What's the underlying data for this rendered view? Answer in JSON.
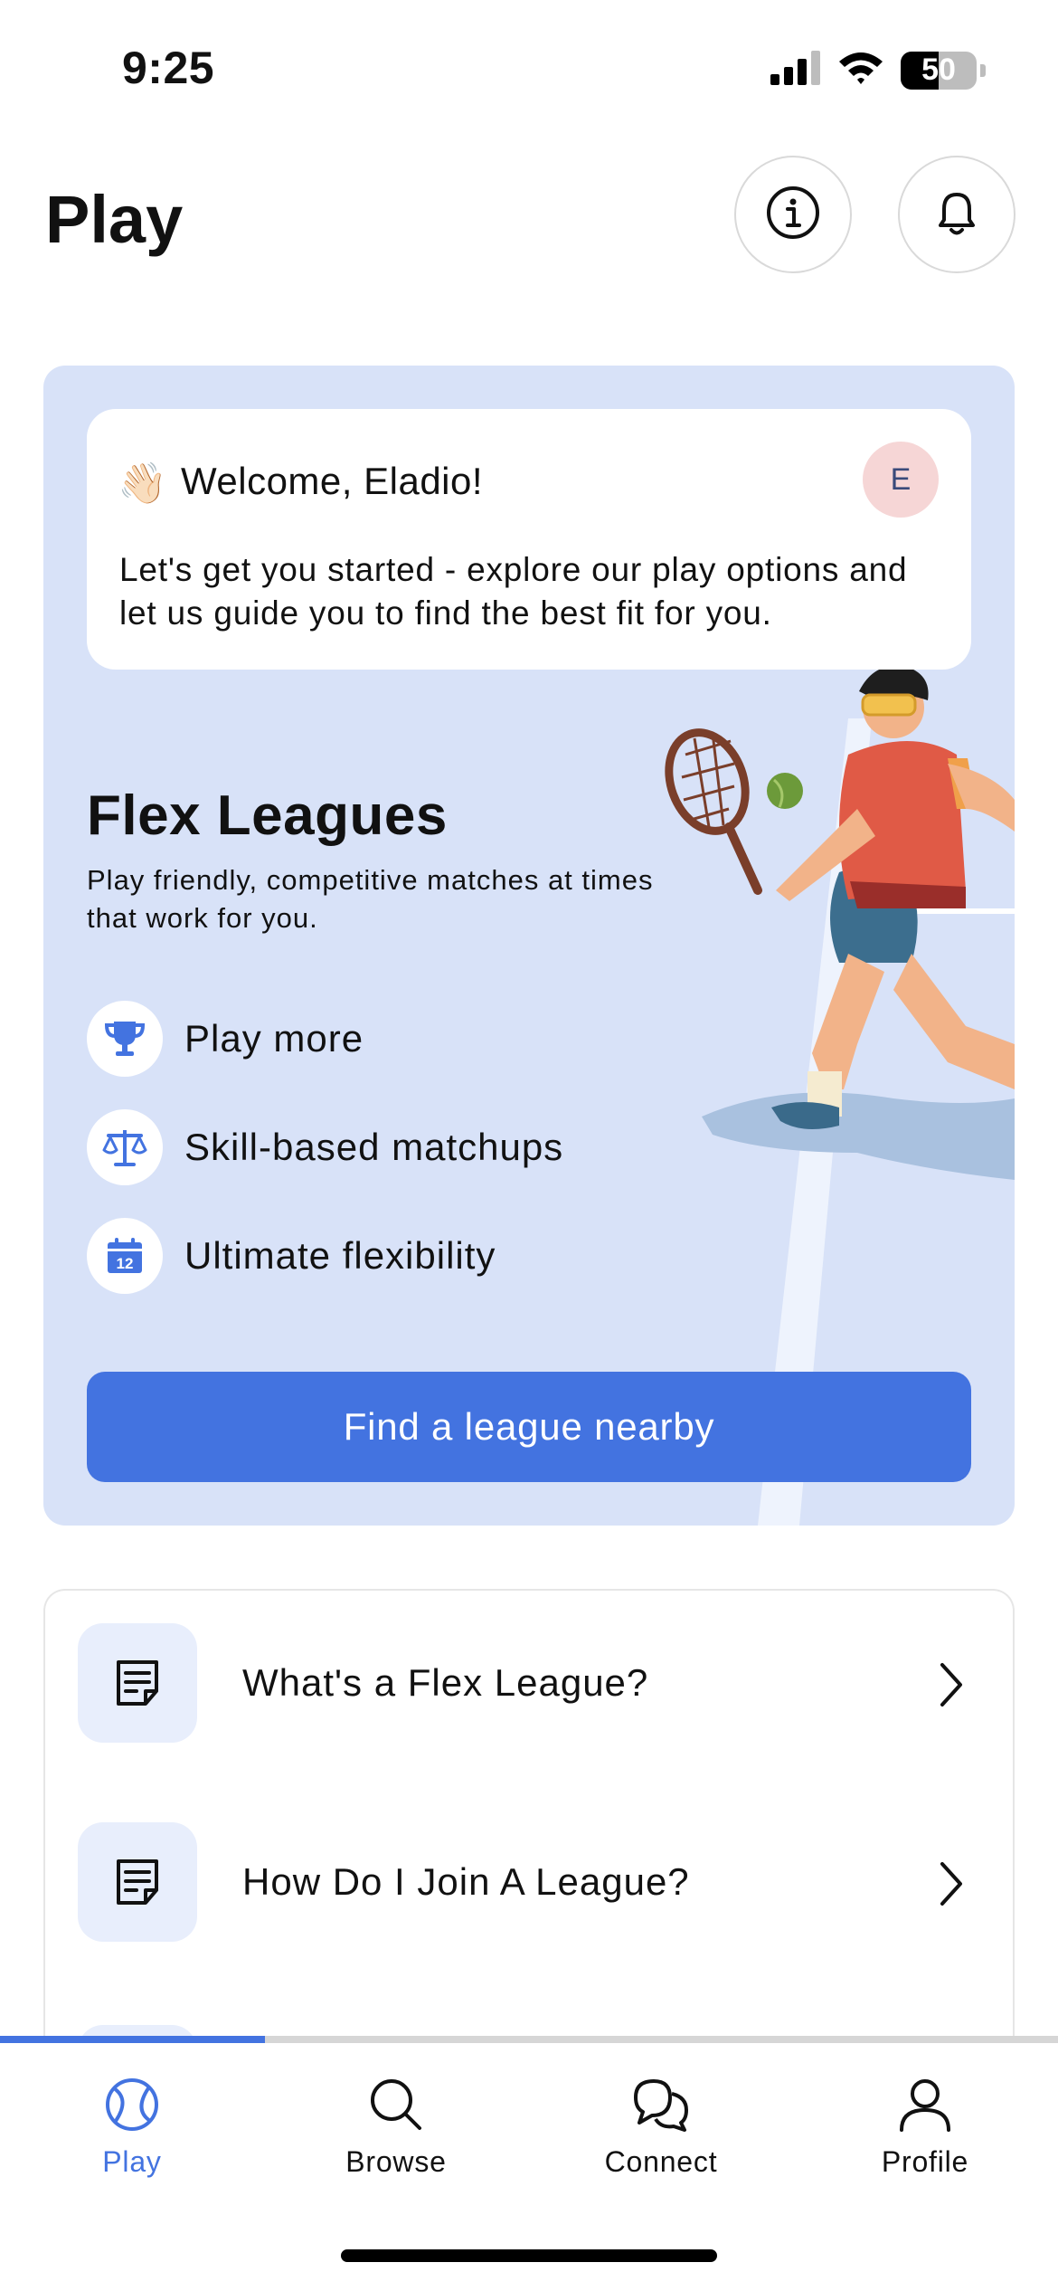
{
  "status_bar": {
    "time": "9:25",
    "battery_percent": 50,
    "battery_label": "50",
    "icons": [
      "signal-icon",
      "wifi-icon",
      "battery-icon"
    ]
  },
  "header": {
    "title": "Play",
    "info_icon": "info-icon",
    "bell_icon": "bell-icon"
  },
  "welcome": {
    "emoji": "👋🏻",
    "title": "Welcome, Eladio!",
    "avatar_initial": "E",
    "body": "Let's get you started - explore our play options and let us guide you to find the best fit for you."
  },
  "flex_leagues": {
    "title": "Flex Leagues",
    "subtitle": "Play friendly, competitive matches at times that work for you.",
    "features": [
      {
        "icon": "trophy-icon",
        "label": "Play more"
      },
      {
        "icon": "scales-icon",
        "label": "Skill-based matchups"
      },
      {
        "icon": "calendar-icon",
        "label": "Ultimate flexibility",
        "calendar_day": "12"
      }
    ],
    "cta_label": "Find a league nearby"
  },
  "faq": [
    {
      "icon": "document-icon",
      "label": "What's a Flex League?"
    },
    {
      "icon": "document-icon",
      "label": "How Do I Join A League?"
    }
  ],
  "tab_bar": {
    "scroll_progress": 0.25,
    "tabs": [
      {
        "icon": "tennis-ball-icon",
        "label": "Play",
        "active": true
      },
      {
        "icon": "search-icon",
        "label": "Browse",
        "active": false
      },
      {
        "icon": "chat-bubbles-icon",
        "label": "Connect",
        "active": false
      },
      {
        "icon": "person-icon",
        "label": "Profile",
        "active": false
      }
    ]
  },
  "colors": {
    "accent": "#4373e0",
    "hero_background": "#d8e2f8",
    "avatar_background": "#f6d6d6"
  }
}
